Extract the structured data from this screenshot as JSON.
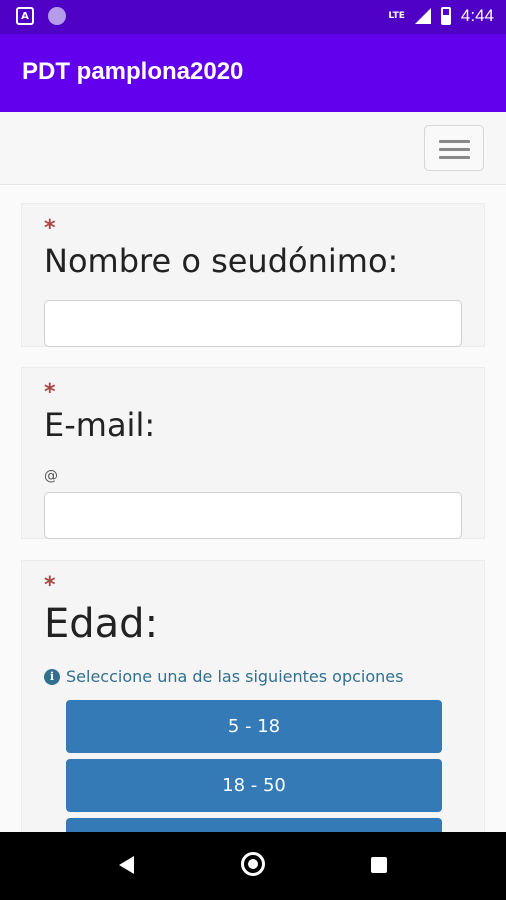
{
  "status_bar": {
    "left_icons": [
      "android-icon",
      "circle-notification-icon"
    ],
    "network": "LTE",
    "time": "4:44"
  },
  "app_bar": {
    "title": "PDT pamplona2020"
  },
  "navbar": {
    "menu_icon": "hamburger-menu-icon"
  },
  "form": {
    "required_marker": "*",
    "name_field": {
      "label": "Nombre o seudónimo:",
      "value": "",
      "placeholder": ""
    },
    "email_field": {
      "label": "E-mail:",
      "prefix": "@",
      "value": "",
      "placeholder": ""
    },
    "age_field": {
      "label": "Edad:",
      "info_icon": "i",
      "hint": "Seleccione una de las siguientes opciones",
      "options": [
        "5 - 18",
        "18 - 50",
        ""
      ]
    }
  },
  "colors": {
    "status_bar": "#4f02c5",
    "app_bar": "#6200ee",
    "required": "#a94442",
    "option_button": "#337ab7",
    "hint_text": "#31708f"
  }
}
